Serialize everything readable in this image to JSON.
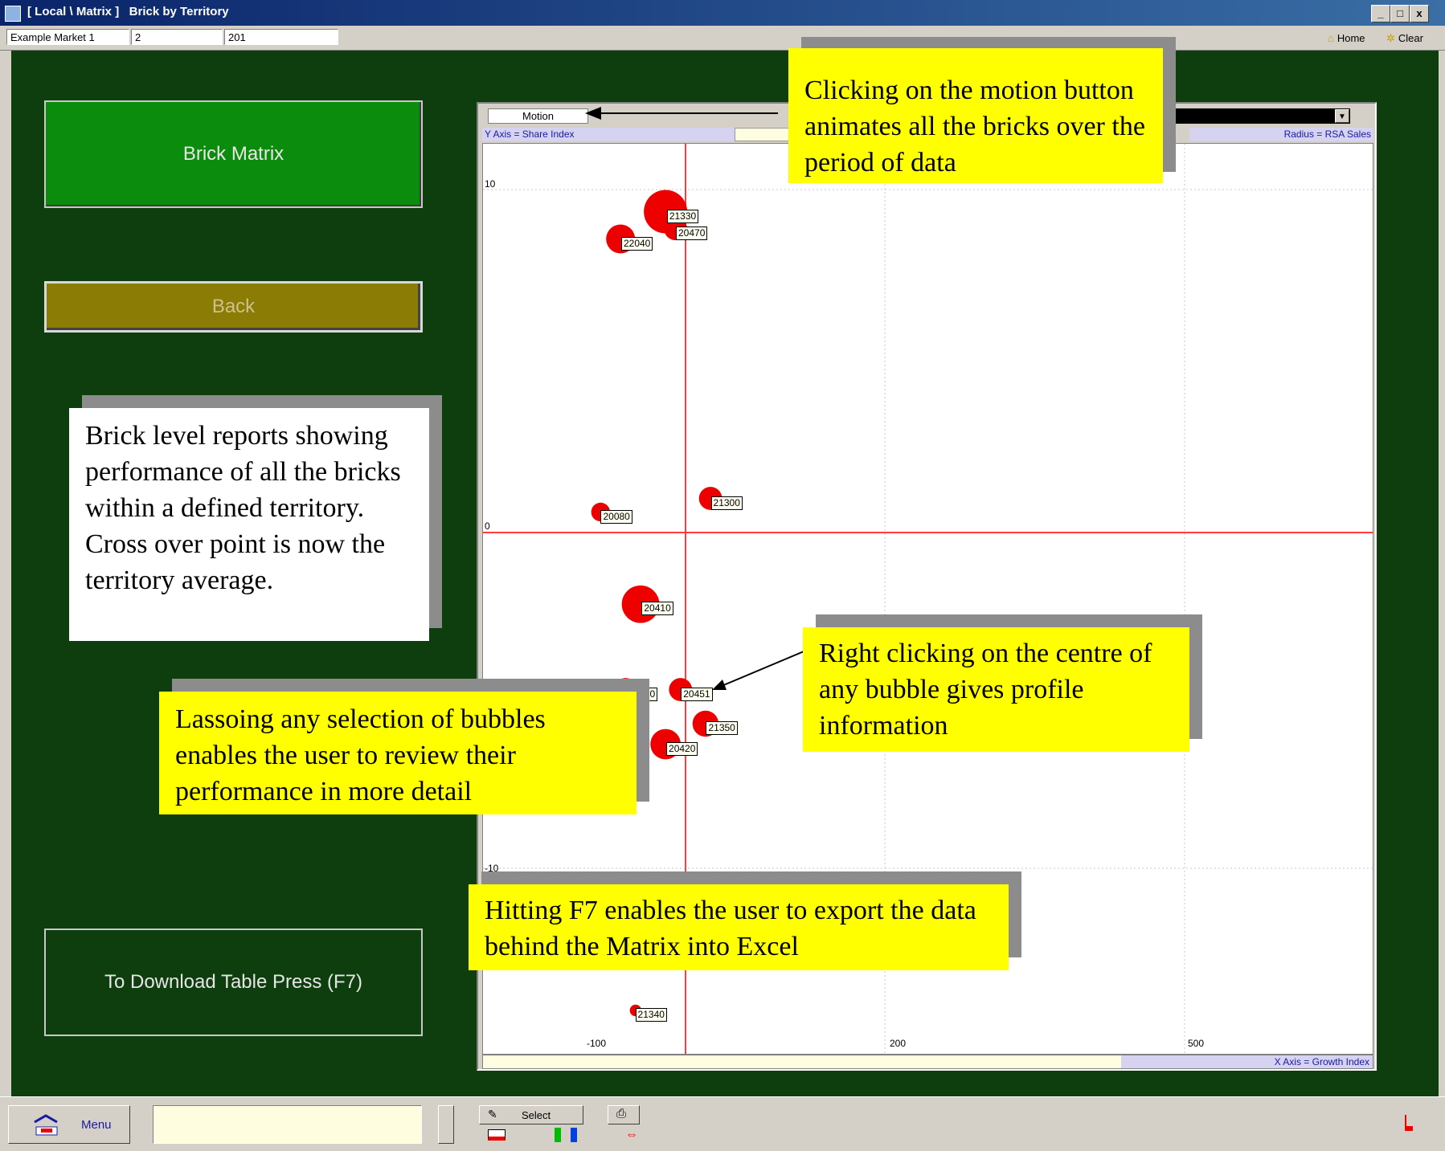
{
  "window": {
    "title": "[ Local \\ Matrix ]   Brick by Territory",
    "controls": [
      "_",
      "□",
      "x"
    ]
  },
  "toolbar": {
    "market": "Example Market 1",
    "field2": "2",
    "field3": "201",
    "home_label": "Home",
    "clear_label": "Clear"
  },
  "nav": {
    "matrix_label": "Brick Matrix",
    "back_label": "Back",
    "download_label": "To Download Table Press (F7)"
  },
  "chart": {
    "motion_label": "Motion",
    "y_axis_label": "Y Axis = Share Index",
    "radius_label": "Radius = RSA Sales",
    "x_axis_label": "X Axis = Growth Index",
    "y_ticks": [
      "10",
      "0",
      "-10"
    ],
    "x_ticks": [
      "-100",
      "200",
      "500"
    ]
  },
  "chart_data": {
    "type": "scatter",
    "xlabel": "X Axis = Growth Index",
    "ylabel": "Y Axis = Share Index",
    "size_label": "Radius = RSA Sales",
    "x_ticks": [
      -100,
      200,
      500
    ],
    "y_ticks": [
      10,
      0,
      -10
    ],
    "points": [
      {
        "label": "21330",
        "x": -20,
        "y": 9.4,
        "r": 3
      },
      {
        "label": "20470",
        "x": -10,
        "y": 8.9,
        "r": 1.6
      },
      {
        "label": "22040",
        "x": -65,
        "y": 8.6,
        "r": 2
      },
      {
        "label": "21300",
        "x": 25,
        "y": 1.0,
        "r": 1.6
      },
      {
        "label": "20080",
        "x": -85,
        "y": 0.6,
        "r": 1.3
      },
      {
        "label": "20410",
        "x": -45,
        "y": -2.1,
        "r": 2.6
      },
      {
        "label": "20370",
        "x": -60,
        "y": -4.6,
        "r": 1.6
      },
      {
        "label": "20451",
        "x": -5,
        "y": -4.6,
        "r": 1.6
      },
      {
        "label": "21350",
        "x": 20,
        "y": -5.6,
        "r": 1.8
      },
      {
        "label": "20420",
        "x": -20,
        "y": -6.2,
        "r": 2.1
      },
      {
        "label": "21340",
        "x": -50,
        "y": -14.0,
        "r": 0.8
      }
    ]
  },
  "callouts": {
    "motion": "Clicking on the motion button animates all the bricks over the period of data",
    "brick": "Brick level reports showing performance of all the bricks within a defined territory. Cross over point is now the territory average.",
    "right_click": "Right clicking on the centre of any bubble gives profile information",
    "lasso": "Lassoing any selection of bubbles enables the user to review their performance in more detail",
    "f7": "Hitting F7 enables the user to export the data behind the Matrix into Excel"
  },
  "statusbar": {
    "menu_label": "Menu",
    "select_label": "Select"
  },
  "colors": {
    "background": "#0e3d0e",
    "bubble": "#ee0000",
    "callout": "#ffff00",
    "crossline": "#ff3b3b"
  }
}
